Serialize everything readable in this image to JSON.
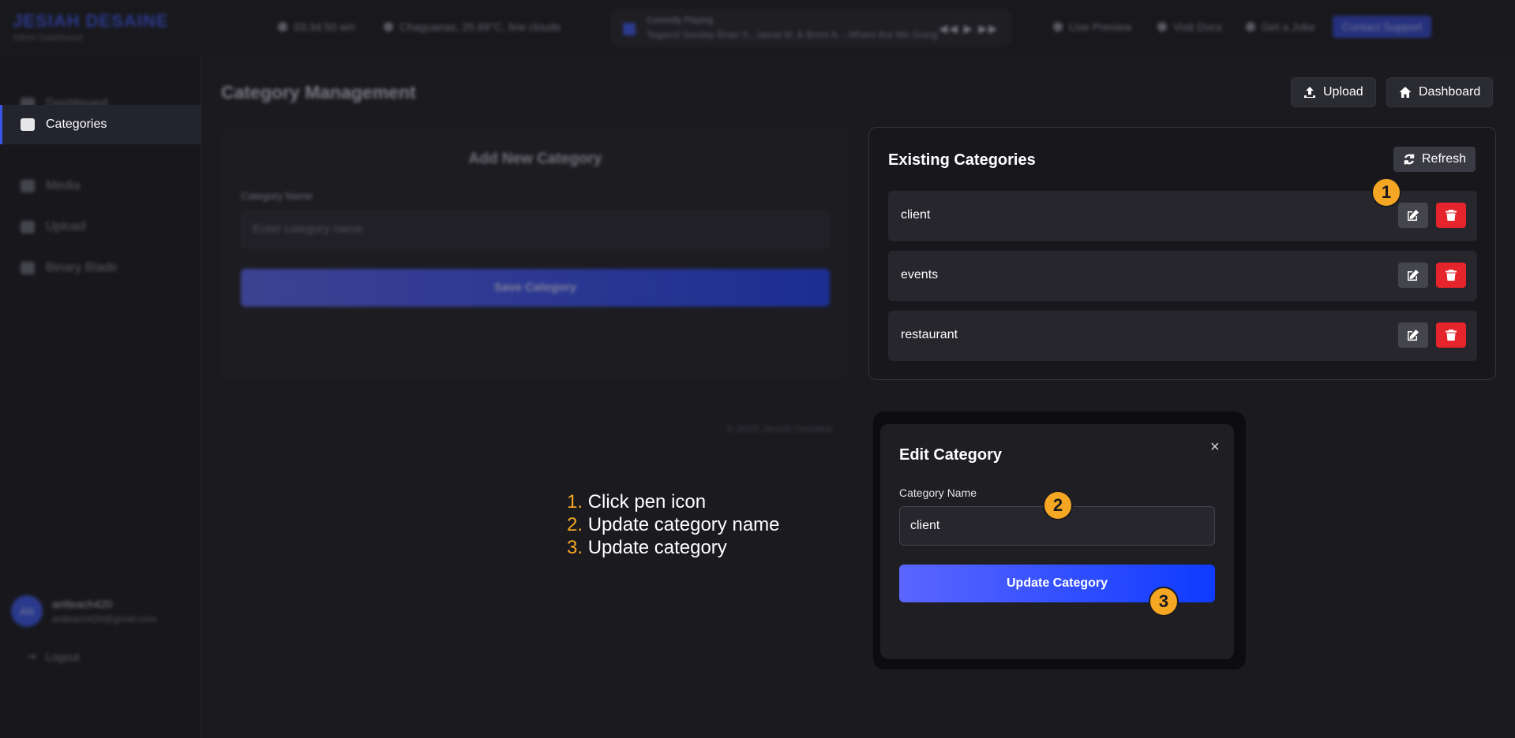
{
  "topbar": {
    "brand_name": "JESIAH DESAINE",
    "brand_sub": "Admin Dashboard",
    "time": "03:34:50 am",
    "weather": "Chaguanas, 25.89°C, few clouds",
    "player_label": "Currently Playing",
    "player_track": "Tegazot Sunday Brian S., Jamal M. & Brent A. - Where Are We Going",
    "player_controls": "◀◀ ▶ ▶▶",
    "live_preview": "Live Preview",
    "visit_docs": "Visit Docs",
    "get_a_joke": "Get a Joke",
    "contact_support": "Contact Support"
  },
  "sidebar": {
    "items": [
      {
        "label": "Dashboard"
      },
      {
        "label": "Categories"
      },
      {
        "label": "Media"
      },
      {
        "label": "Upload"
      },
      {
        "label": "Binary Blade"
      }
    ],
    "user_initials": "AN",
    "user_name": "antleach420",
    "user_email": "antleach420@gmail.com",
    "logout": "Logout"
  },
  "main": {
    "title": "Category Management",
    "upload_label": "Upload",
    "dashboard_label": "Dashboard",
    "add_card": {
      "title": "Add New Category",
      "field_label": "Category Name",
      "placeholder": "Enter category name",
      "save_label": "Save Category"
    },
    "existing": {
      "title": "Existing Categories",
      "refresh_label": "Refresh",
      "categories": [
        "client",
        "events",
        "restaurant"
      ]
    },
    "footer": "© 2025 Jesiah Desaine"
  },
  "modal": {
    "title": "Edit Category",
    "close": "×",
    "field_label": "Category Name",
    "value": "client",
    "update_label": "Update Category"
  },
  "annotations": {
    "badges": [
      "1",
      "2",
      "3"
    ],
    "steps": [
      {
        "num": "1.",
        "text": "Click pen icon"
      },
      {
        "num": "2.",
        "text": "Update category name"
      },
      {
        "num": "3.",
        "text": "Update category"
      }
    ]
  },
  "colors": {
    "accent": "#3a55e8",
    "delete": "#e5242b",
    "badge": "#f5a623",
    "background": "#1a1a1f"
  }
}
